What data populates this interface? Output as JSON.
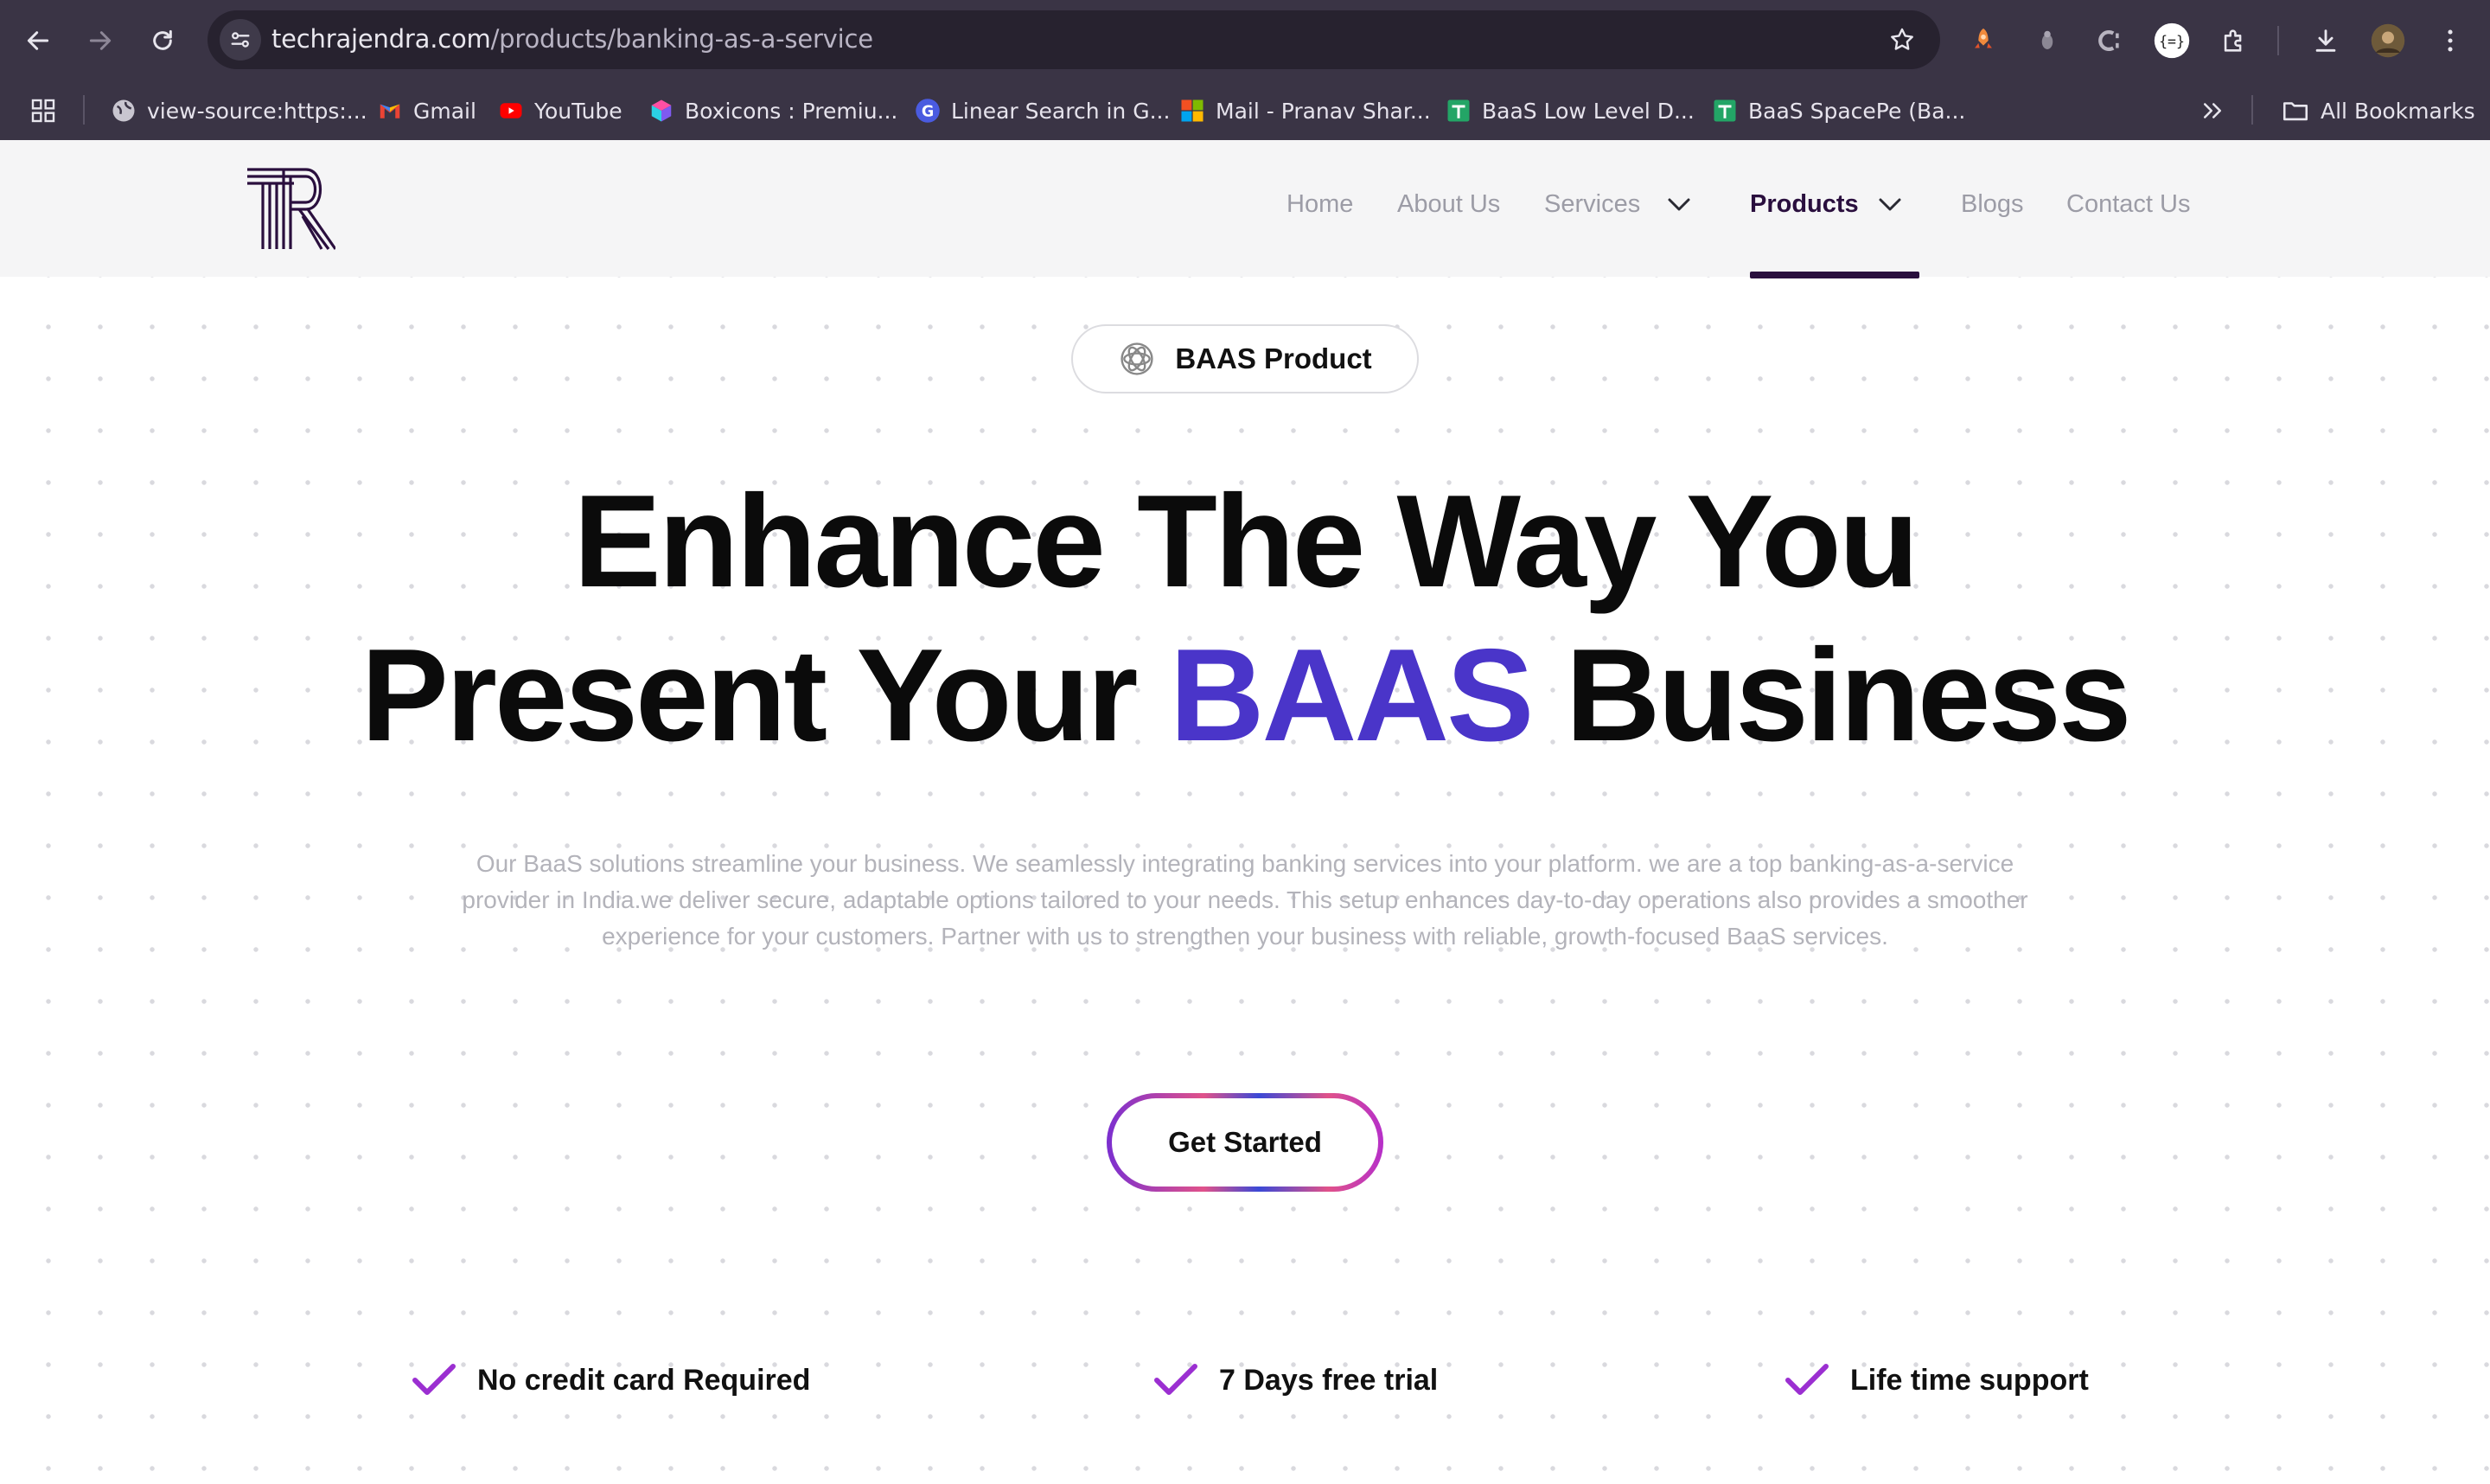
{
  "browser": {
    "url_host": "techrajendra.com",
    "url_path": "/products/banking-as-a-service",
    "bookmarks": [
      {
        "label": "view-source:https:...",
        "icon": "globe-icon"
      },
      {
        "label": "Gmail",
        "icon": "gmail-icon"
      },
      {
        "label": "YouTube",
        "icon": "youtube-icon"
      },
      {
        "label": "Boxicons : Premiu...",
        "icon": "boxicons-icon"
      },
      {
        "label": "Linear Search in G...",
        "icon": "google-icon"
      },
      {
        "label": "Mail - Pranav Shar...",
        "icon": "microsoft-icon"
      },
      {
        "label": "BaaS Low Level D...",
        "icon": "sheets-icon"
      },
      {
        "label": "BaaS SpacePe (Ba...",
        "icon": "sheets-icon"
      }
    ],
    "all_bookmarks_label": "All Bookmarks"
  },
  "nav": {
    "items": [
      {
        "label": "Home"
      },
      {
        "label": "About Us"
      },
      {
        "label": "Services"
      },
      {
        "label": "Products"
      },
      {
        "label": "Blogs"
      },
      {
        "label": "Contact Us"
      }
    ],
    "active": "Products"
  },
  "hero": {
    "badge": "BAAS Product",
    "headline_line1": "Enhance The Way You",
    "headline_line2_before": "Present Your ",
    "headline_line2_accent": "BAAS",
    "headline_line2_after": " Business",
    "description": "Our BaaS solutions streamline your business. We seamlessly integrating banking services into your platform. we are a top banking-as-a-service provider in India.we deliver secure, adaptable options tailored to your needs. This setup enhances day-to-day operations also provides a smoother experience for your customers. Partner with us to strengthen your business with reliable, growth-focused BaaS services.",
    "cta_label": "Get Started"
  },
  "features": [
    {
      "label": "No credit card Required"
    },
    {
      "label": "7 Days free trial"
    },
    {
      "label": "Life time support"
    }
  ],
  "colors": {
    "accent": "#4a35c9",
    "nav_active": "#2a0f3e",
    "check": "#9b2fd1"
  }
}
